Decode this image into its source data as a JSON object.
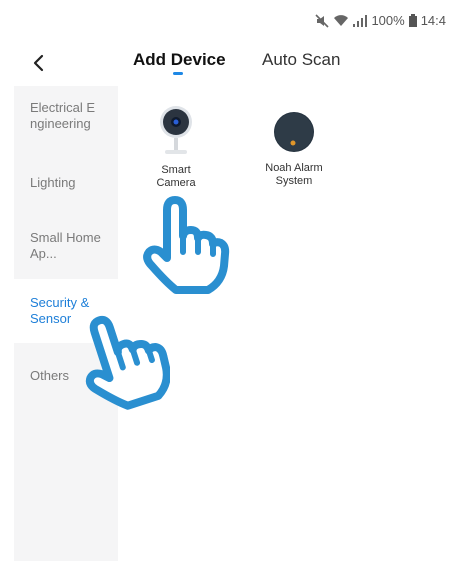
{
  "status_bar": {
    "battery": "100%",
    "time": "14:4",
    "icons": [
      "mute-icon",
      "wifi-icon",
      "signal-icon",
      "battery-icon"
    ]
  },
  "header": {
    "back_icon": "chevron-left-icon",
    "tabs": [
      {
        "label": "Add Device",
        "active": true
      },
      {
        "label": "Auto Scan",
        "active": false
      }
    ]
  },
  "sidebar": {
    "items": [
      {
        "label": "Electrical E ngineering",
        "active": false
      },
      {
        "label": "Lighting",
        "active": false
      },
      {
        "label": "Small Home Ap...",
        "active": false
      },
      {
        "label": "Security & Sensor",
        "active": true
      },
      {
        "label": "Others",
        "active": false
      }
    ]
  },
  "devices": [
    {
      "name": "Smart Camera",
      "icon": "camera-icon"
    },
    {
      "name": "Noah Alarm System",
      "icon": "alarm-system-icon"
    }
  ],
  "overlays": [
    "pointing-hand-icon",
    "pointing-hand-icon"
  ],
  "colors": {
    "accent": "#1e88e5",
    "sidebar_bg": "#f5f5f6",
    "hand_stroke": "#2a8fd0"
  }
}
